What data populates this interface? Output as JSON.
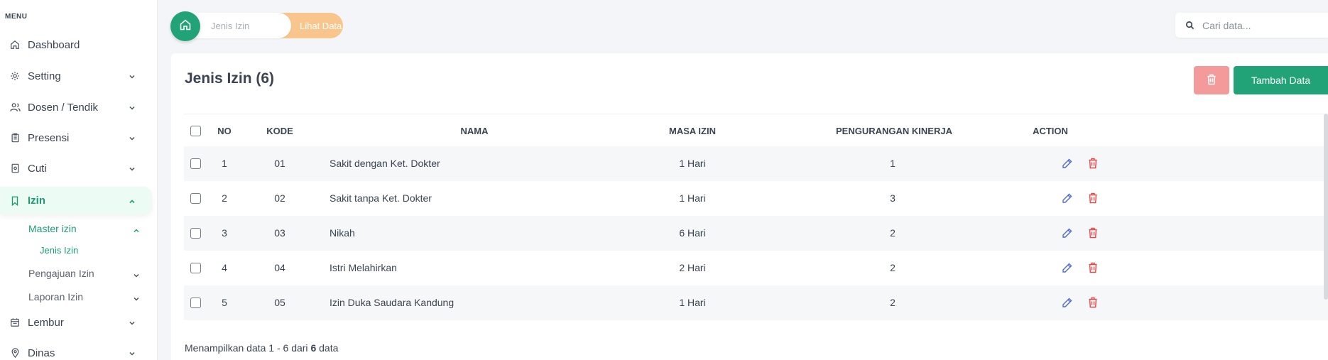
{
  "sidebar": {
    "menu_title": "MENU",
    "items": [
      {
        "label": "Dashboard"
      },
      {
        "label": "Setting"
      },
      {
        "label": "Dosen / Tendik"
      },
      {
        "label": "Presensi"
      },
      {
        "label": "Cuti"
      },
      {
        "label": "Izin"
      },
      {
        "label": "Lembur"
      },
      {
        "label": "Dinas"
      }
    ],
    "sub_items": {
      "master_izin": "Master izin",
      "jenis_izin": "Jenis Izin",
      "pengajuan_izin": "Pengajuan Izin",
      "laporan_izin": "Laporan Izin"
    }
  },
  "breadcrumb": {
    "step1": "Jenis Izin",
    "step2": "Lihat Data"
  },
  "search": {
    "placeholder": "Cari data..."
  },
  "card": {
    "title": "Jenis Izin (6)",
    "add_label": "Tambah Data"
  },
  "table": {
    "headers": {
      "no": "NO",
      "kode": "KODE",
      "nama": "NAMA",
      "masa_izin": "MASA IZIN",
      "pengurangan": "PENGURANGAN KINERJA",
      "action": "ACTION"
    },
    "rows": [
      {
        "no": "1",
        "kode": "01",
        "nama": "Sakit dengan Ket. Dokter",
        "masa": "1 Hari",
        "pengurangan": "1"
      },
      {
        "no": "2",
        "kode": "02",
        "nama": "Sakit tanpa Ket. Dokter",
        "masa": "1 Hari",
        "pengurangan": "3"
      },
      {
        "no": "3",
        "kode": "03",
        "nama": "Nikah",
        "masa": "6 Hari",
        "pengurangan": "2"
      },
      {
        "no": "4",
        "kode": "04",
        "nama": "Istri Melahirkan",
        "masa": "2 Hari",
        "pengurangan": "2"
      },
      {
        "no": "5",
        "kode": "05",
        "nama": "Izin Duka Saudara Kandung",
        "masa": "1 Hari",
        "pengurangan": "2"
      }
    ]
  },
  "footer": {
    "prefix": "Menampilkan data 1 - 6 dari ",
    "total": "6",
    "suffix": " data"
  },
  "colors": {
    "primary": "#21a277",
    "accent_orange": "#f8c68c",
    "danger_light": "#f59a9a",
    "edit_icon": "#4f6ad8",
    "delete_icon": "#e04848"
  }
}
